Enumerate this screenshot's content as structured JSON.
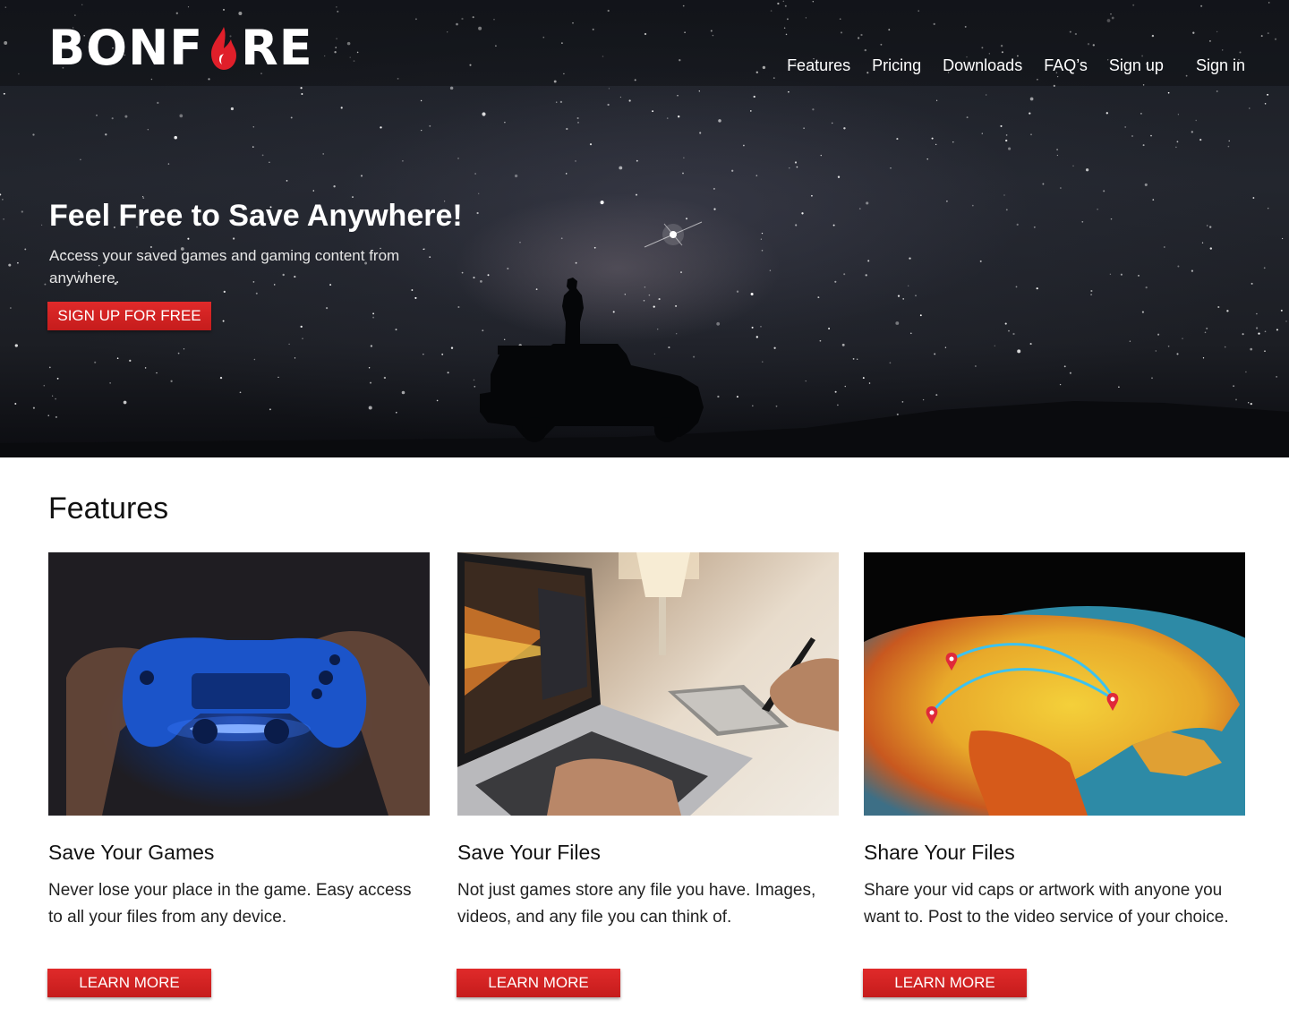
{
  "brand": {
    "name_left": "BONF",
    "name_right": "RE",
    "flame_color": "#e01f2a"
  },
  "nav": {
    "items": [
      "Features",
      "Pricing",
      "Downloads",
      "FAQ’s",
      "Sign up",
      "Sign in"
    ]
  },
  "hero": {
    "title": "Feel Free to Save Anywhere!",
    "subtitle": "Access your saved games and gaming content from anywhere.",
    "cta": "SIGN UP FOR FREE"
  },
  "features": {
    "heading": "Features",
    "cards": [
      {
        "title": "Save Your Games",
        "text": "Never lose your place in the game. Easy access to all your files from any device.",
        "button": "LEARN MORE",
        "image_icon": "game-controller-photo"
      },
      {
        "title": "Save Your Files",
        "text": "Not just games store any file you have. Images, videos, and any file you can think of.",
        "button": "LEARN MORE",
        "image_icon": "laptop-tablet-photo"
      },
      {
        "title": "Share Your Files",
        "text": "Share your vid caps or artwork with anyone you want to. Post to the video service of your choice.",
        "button": "LEARN MORE",
        "image_icon": "globe-map-photo"
      }
    ]
  },
  "colors": {
    "accent": "#d42222",
    "hero_bg": "#1c1e24"
  }
}
